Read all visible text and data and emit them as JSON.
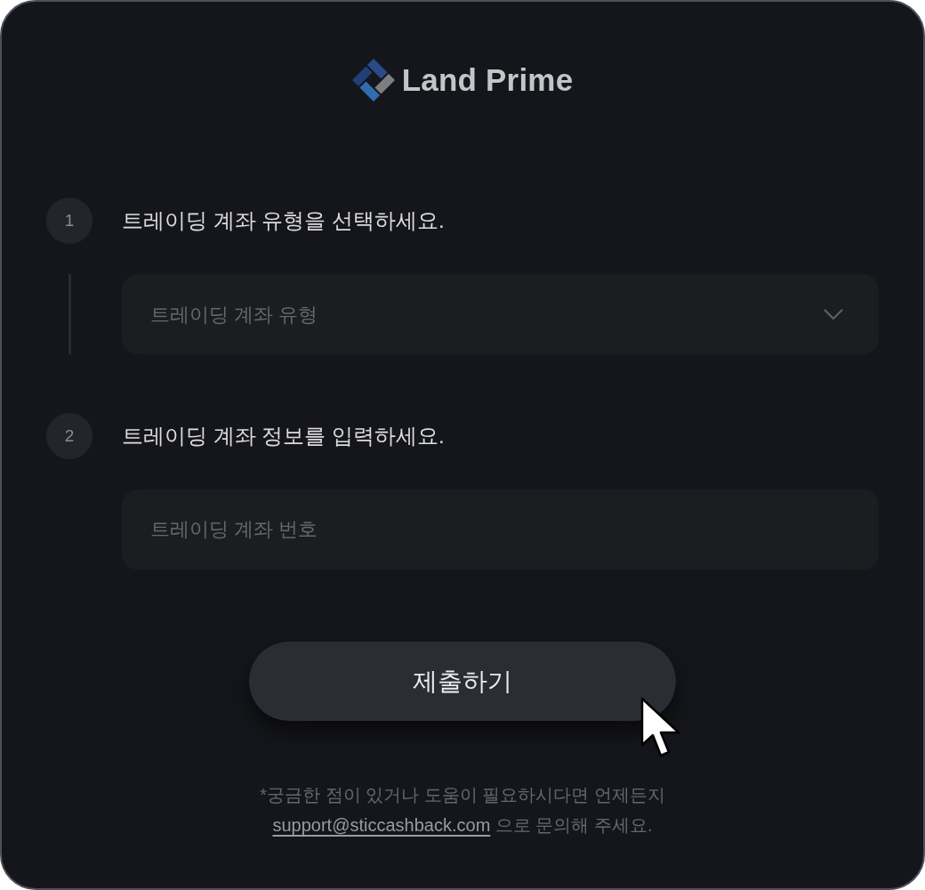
{
  "logo": {
    "text": "Land Prime"
  },
  "steps": [
    {
      "number": "1",
      "title": "트레이딩 계좌 유형을 선택하세요.",
      "field": {
        "kind": "select",
        "placeholder": "트레이딩 계좌 유형"
      }
    },
    {
      "number": "2",
      "title": "트레이딩 계좌 정보를 입력하세요.",
      "field": {
        "kind": "text",
        "placeholder": "트레이딩 계좌 번호"
      }
    }
  ],
  "submit_button": {
    "label": "제출하기"
  },
  "help": {
    "line_1": "*궁금한 점이 있거나 도움이 필요하시다면 언제든지",
    "link": "support@sticcashback.com",
    "line_2": "으로 문의해 주세요."
  }
}
